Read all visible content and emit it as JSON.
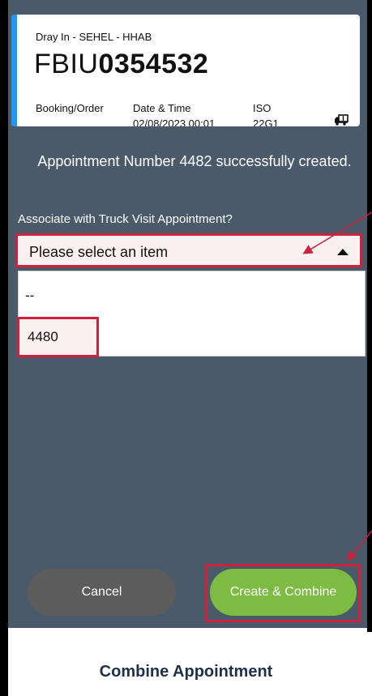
{
  "card": {
    "subtitle": "Dray In - SEHEL - HHAB",
    "container_prefix": "FBIU",
    "container_number": "0354532",
    "booking_label": "Booking/Order",
    "booking_value": "",
    "datetime_label": "Date & Time",
    "datetime_value": "02/08/2023 00:01",
    "iso_label": "ISO",
    "iso_value": "22G1",
    "icon": "truck-icon"
  },
  "message": "Appointment Number 4482 successfully created.",
  "associate_label": "Associate with Truck Visit Appointment?",
  "select": {
    "placeholder": "Please select an item",
    "options": [
      "--",
      "4480"
    ]
  },
  "buttons": {
    "cancel": "Cancel",
    "create": "Create & Combine"
  },
  "footer_title": "Combine Appointment",
  "colors": {
    "screen_bg": "#4a5a6a",
    "accent_blue": "#2196f3",
    "highlight_red": "#d0203a",
    "create_green": "#7dbb43",
    "cancel_grey": "#5c5c5c",
    "footer_text": "#1f3149"
  }
}
